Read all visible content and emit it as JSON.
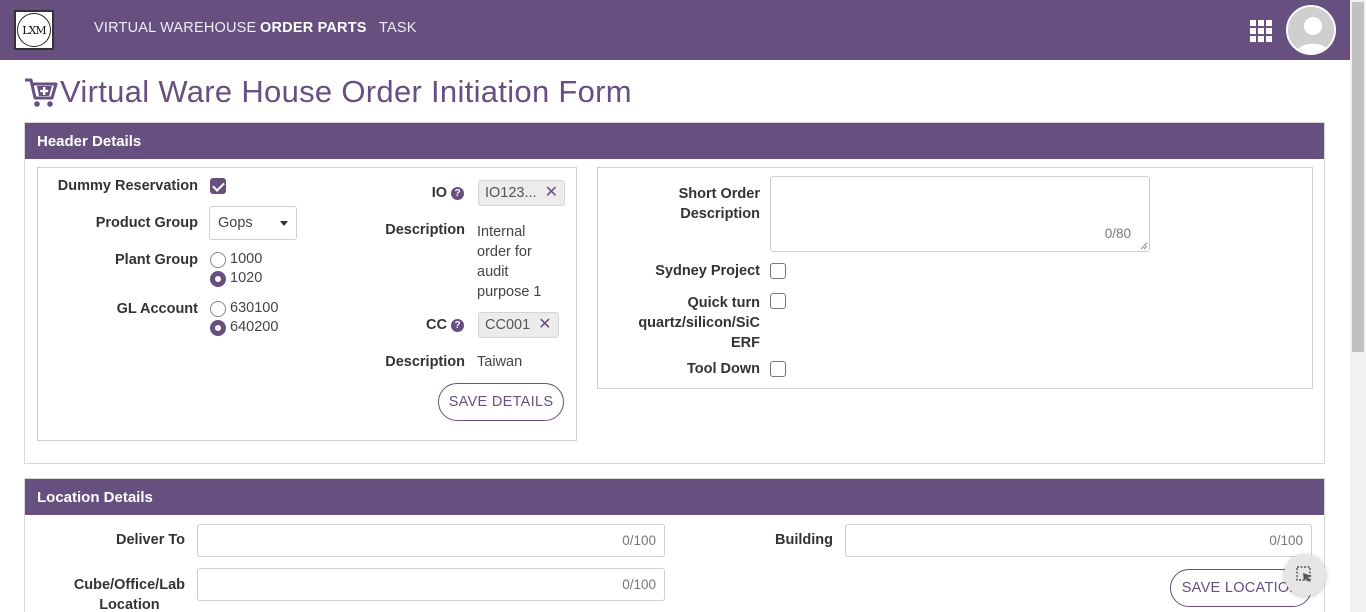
{
  "nav": {
    "logo_text": "LXM",
    "links": [
      "VIRTUAL WAREHOUSE",
      "ORDER PARTS",
      "TASK"
    ],
    "active_index": 1
  },
  "page": {
    "title": "Virtual Ware House Order Initiation Form"
  },
  "header_details": {
    "heading": "Header Details",
    "dummy_reservation": {
      "label": "Dummy Reservation",
      "checked": true
    },
    "product_group": {
      "label": "Product Group",
      "value": "Gops"
    },
    "plant_group": {
      "label": "Plant Group",
      "options": [
        "1000",
        "1020"
      ],
      "selected": "1020"
    },
    "gl_account": {
      "label": "GL Account",
      "options": [
        "630100",
        "640200"
      ],
      "selected": "640200"
    },
    "io": {
      "label": "IO",
      "value": "IO123..."
    },
    "io_description": {
      "label": "Description",
      "lines": [
        "Internal",
        "order for",
        "audit",
        "purpose 1"
      ]
    },
    "cc": {
      "label": "CC",
      "value": "CC001"
    },
    "cc_description": {
      "label": "Description",
      "value": "Taiwan"
    },
    "save_button": "SAVE DETAILS",
    "short_order_description": {
      "label_lines": [
        "Short Order",
        "Description"
      ],
      "counter": "0/80"
    },
    "sydney_project": {
      "label": "Sydney Project",
      "checked": false
    },
    "quick_turn": {
      "label_lines": [
        "Quick turn",
        "quartz/silicon/SiC",
        "ERF"
      ],
      "checked": false
    },
    "tool_down": {
      "label": "Tool Down",
      "checked": false
    }
  },
  "location_details": {
    "heading": "Location Details",
    "deliver_to": {
      "label": "Deliver To",
      "counter": "0/100"
    },
    "building": {
      "label": "Building",
      "counter": "0/100"
    },
    "cube_office": {
      "label_lines": [
        "Cube/Office/Lab",
        "Location"
      ],
      "counter": "0/100"
    },
    "save_button": "SAVE LOCATION"
  },
  "colors": {
    "brand": "#674f80"
  }
}
